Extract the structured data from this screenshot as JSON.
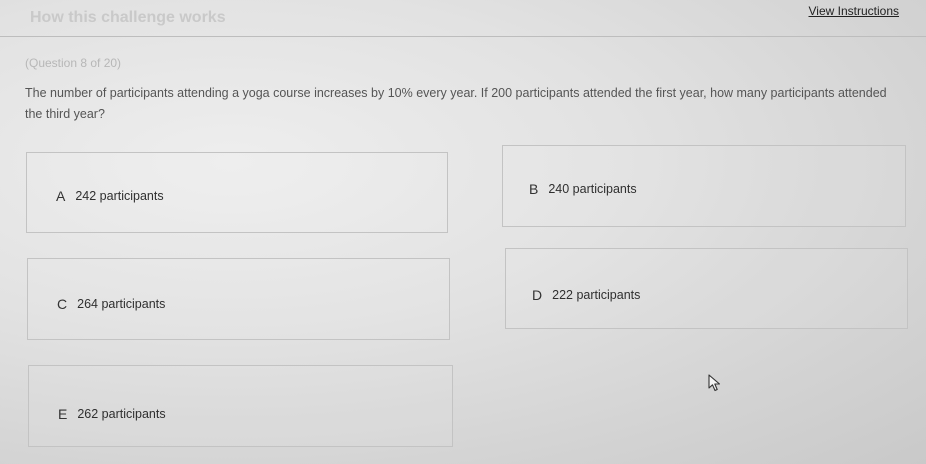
{
  "header": {
    "title": "How this challenge works",
    "instructions_link": "View Instructions"
  },
  "question": {
    "counter": "(Question 8 of 20)",
    "text": "The number of participants attending a yoga course increases by 10% every year. If 200 participants attended the first year, how many participants attended the third year?"
  },
  "options": [
    {
      "letter": "A",
      "label": "242 participants"
    },
    {
      "letter": "B",
      "label": "240 participants"
    },
    {
      "letter": "C",
      "label": "264 participants"
    },
    {
      "letter": "D",
      "label": "222 participants"
    },
    {
      "letter": "E",
      "label": "262 participants"
    }
  ],
  "icons": {
    "cursor": "mouse-pointer-icon"
  }
}
